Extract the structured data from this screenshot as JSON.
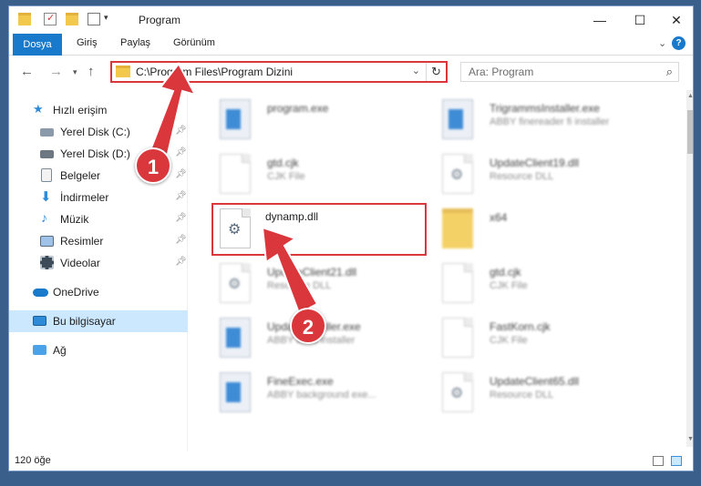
{
  "window": {
    "title": "Program"
  },
  "ribbon": {
    "tabs": [
      "Dosya",
      "Giriş",
      "Paylaş",
      "Görünüm"
    ],
    "help": "?"
  },
  "address": {
    "path": "C:\\Program Files\\Program Dizini",
    "refresh": "↻",
    "dropdown": "⌄"
  },
  "search": {
    "placeholder": "Ara: Program"
  },
  "sidebar": {
    "items": [
      {
        "label": "Hızlı erişim",
        "icon": "star-icon",
        "pinned": false
      },
      {
        "label": "Yerel Disk (C:)",
        "icon": "drive-icon",
        "pinned": true
      },
      {
        "label": "Yerel Disk (D:)",
        "icon": "drive-icon",
        "pinned": true
      },
      {
        "label": "Belgeler",
        "icon": "documents-icon",
        "pinned": true
      },
      {
        "label": "İndirmeler",
        "icon": "download-icon",
        "pinned": true
      },
      {
        "label": "Müzik",
        "icon": "music-icon",
        "pinned": true
      },
      {
        "label": "Resimler",
        "icon": "pictures-icon",
        "pinned": true
      },
      {
        "label": "Videolar",
        "icon": "videos-icon",
        "pinned": true
      },
      {
        "label": "OneDrive",
        "icon": "cloud-icon",
        "pinned": false
      },
      {
        "label": "Bu bilgisayar",
        "icon": "computer-icon",
        "pinned": false,
        "selected": true
      },
      {
        "label": "Ağ",
        "icon": "network-icon",
        "pinned": false
      }
    ]
  },
  "files": [
    {
      "name": "program.exe",
      "type": "",
      "icon": "exe"
    },
    {
      "name": "TrigrammsInstaller.exe",
      "type": "ABBY finereader fi installer",
      "icon": "exe"
    },
    {
      "name": "gtd.cjk",
      "type": "CJK File",
      "icon": "doc"
    },
    {
      "name": "UpdateClient19.dll",
      "type": "Resource DLL",
      "icon": "dll"
    },
    {
      "name": "dynamp.dll",
      "type": "",
      "icon": "dll",
      "highlighted": true
    },
    {
      "name": "x64",
      "type": "",
      "icon": "folder"
    },
    {
      "name": "UpdateClient21.dll",
      "type": "Resource DLL",
      "icon": "dll"
    },
    {
      "name": "gtd.cjk",
      "type": "CJK File",
      "icon": "doc"
    },
    {
      "name": "UpdateInstaller.exe",
      "type": "ABBY fines installer",
      "icon": "exe"
    },
    {
      "name": "FastKorn.cjk",
      "type": "CJK File",
      "icon": "doc"
    },
    {
      "name": "FineExec.exe",
      "type": "ABBY background exe...",
      "icon": "exe"
    },
    {
      "name": "UpdateClient65.dll",
      "type": "Resource DLL",
      "icon": "dll"
    }
  ],
  "status": {
    "count": "120 öğe"
  },
  "callouts": [
    "1",
    "2"
  ],
  "colors": {
    "accent": "#1979ca",
    "highlight": "#d9373b",
    "selection": "#cce8ff"
  }
}
